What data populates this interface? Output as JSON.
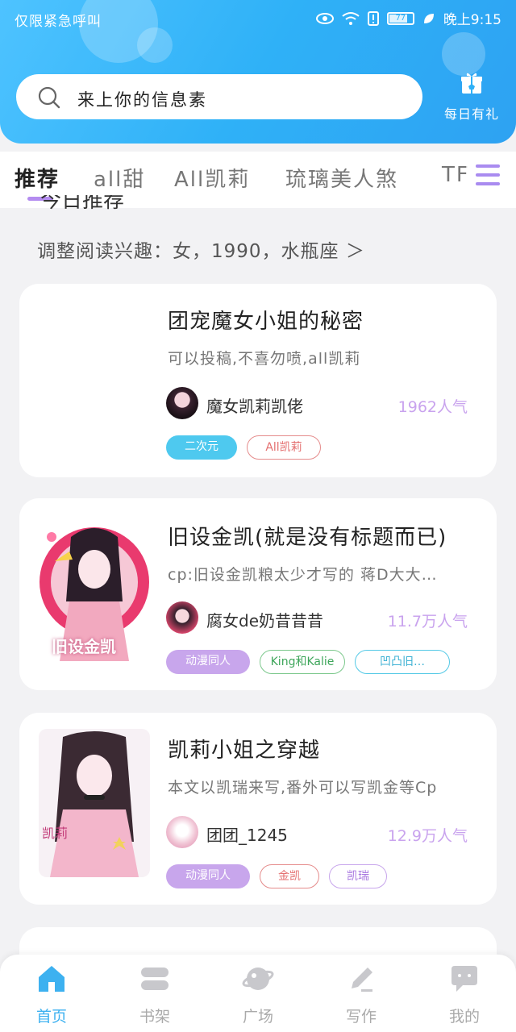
{
  "status_bar": {
    "left_text": "仅限紧急呼叫",
    "battery": "77",
    "time": "晚上9:15"
  },
  "search": {
    "placeholder": "来上你的信息素"
  },
  "gift": {
    "label": "每日有礼",
    "icon": "gift-icon"
  },
  "tabs": [
    {
      "label": "推荐",
      "active": true
    },
    {
      "label": "all甜"
    },
    {
      "label": "All凯莉"
    },
    {
      "label": "琉璃美人煞"
    },
    {
      "label": "TF"
    }
  ],
  "section": {
    "title": "今日推荐",
    "interest": "调整阅读兴趣：女，1990，水瓶座 ＞"
  },
  "books": [
    {
      "title": "团宠魔女小姐的秘密",
      "desc": "可以投稿,不喜勿喷,all凯莉",
      "author": "魔女凯莉凯佬",
      "popularity": "1962人气",
      "tags": [
        "二次元",
        "All凯莉"
      ]
    },
    {
      "title": "旧设金凯(就是没有标题而已)",
      "desc": "cp:旧设金凯粮太少才写的 蒋D大大…",
      "author": "腐女de奶昔昔昔",
      "popularity": "11.7万人气",
      "cover_text": "旧设金凯",
      "tags": [
        "动漫同人",
        "King和Kalie",
        "凹凸旧…"
      ]
    },
    {
      "title": "凯莉小姐之穿越",
      "desc": "本文以凯瑞来写,番外可以写凯金等Cp",
      "author": "团团_1245",
      "popularity": "12.9万人气",
      "cover_text": "凯莉",
      "tags": [
        "动漫同人",
        "金凯",
        "凯瑞"
      ]
    }
  ],
  "bottom_nav": [
    {
      "label": "首页",
      "icon": "home-icon",
      "active": true
    },
    {
      "label": "书架",
      "icon": "bookshelf-icon"
    },
    {
      "label": "广场",
      "icon": "planet-icon"
    },
    {
      "label": "写作",
      "icon": "pen-icon"
    },
    {
      "label": "我的",
      "icon": "chat-bubble-icon"
    }
  ],
  "colors": {
    "header": "#2fb1f7",
    "accent_purple": "#b48cf0",
    "nav_active": "#3db1f0"
  }
}
